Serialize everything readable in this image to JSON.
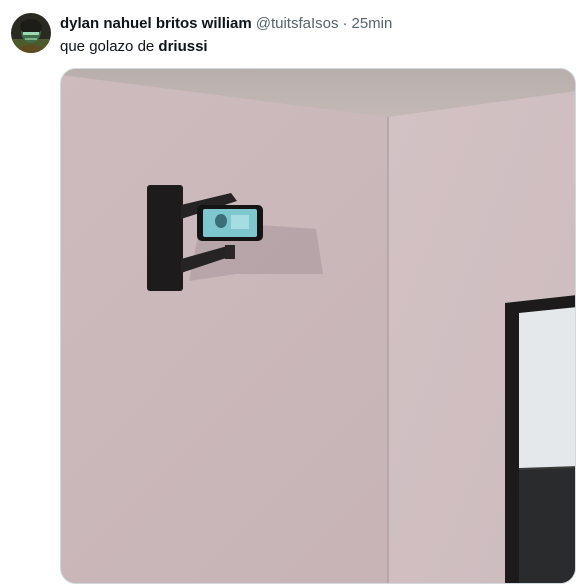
{
  "tweet": {
    "display_name": "dylan nahuel britos william",
    "handle": "@tuitsfaIsos",
    "separator": "·",
    "time": "25min",
    "text_prefix": "que golazo de ",
    "text_bold": "driussi"
  },
  "media": {
    "icon": "photo-wall-mounted-phone",
    "wall_color": "#cbb7ba",
    "ceiling_color": "#b8adab"
  },
  "colors": {
    "text": "#0f1419",
    "secondary_text": "#536471",
    "border": "#cfd9de"
  }
}
